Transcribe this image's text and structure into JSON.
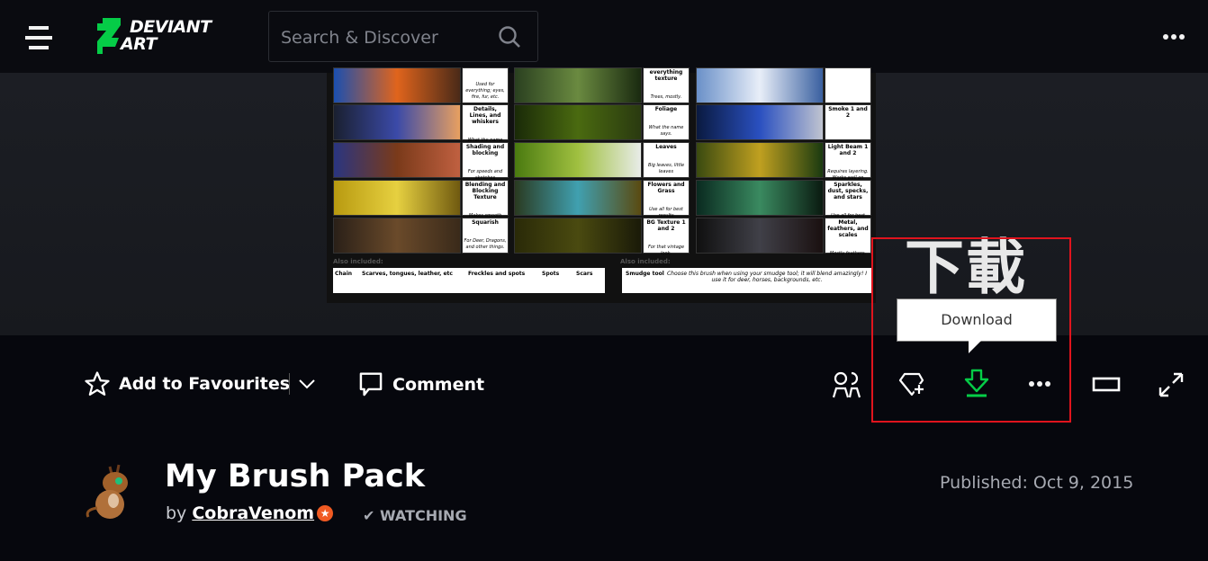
{
  "header": {
    "logo_text": [
      "DEVIANT",
      "ART"
    ],
    "logo_color": "#05cc47",
    "search": {
      "placeholder": "Search & Discover"
    }
  },
  "artwork": {
    "columns": [
      {
        "labels": [
          "",
          "Details, Lines, and whiskers",
          "Shading and blocking",
          "Blending and Blocking Texture",
          "Squarish"
        ],
        "captions": [
          "Used for everything; eyes, fire, fur, etc.",
          "What the name says.",
          "For speeds and sketches",
          "Makes smooth things.",
          "For Deer, Dragons, and other things."
        ],
        "colors": [
          [
            "#1b4fb0",
            "#e0641c",
            "#4a2a18"
          ],
          [
            "#1a2030",
            "#3b4aa8",
            "#e8a060"
          ],
          [
            "#2a3580",
            "#7a3a1a",
            "#c06040"
          ],
          [
            "#b89a10",
            "#e6d040",
            "#705a10"
          ],
          [
            "#2a2018",
            "#6a4a2a",
            "#3a2a1a"
          ]
        ]
      },
      {
        "labels": [
          "everything texture",
          "Foliage",
          "Leaves",
          "Flowers and Grass",
          "BG Texture 1 and 2"
        ],
        "captions": [
          "Trees, mostly.",
          "What the name says.",
          "Big leaves, little leaves",
          "Use all for best results",
          "For that vintage look."
        ],
        "colors": [
          [
            "#2a4020",
            "#6a8a40",
            "#1a2a10"
          ],
          [
            "#1a2a08",
            "#4a6a10",
            "#2a3a10"
          ],
          [
            "#4a7a10",
            "#a0c040",
            "#e8ece8"
          ],
          [
            "#2a3a20",
            "#40a0b0",
            "#5a4a10"
          ],
          [
            "#2a2a08",
            "#4a4a10",
            "#1a1a08"
          ]
        ]
      },
      {
        "labels": [
          "",
          "Smoke 1 and 2",
          "Light Beam 1 and 2",
          "Sparkles, dust, specks, and stars",
          "Metal, feathers, and scales"
        ],
        "captions": [
          "",
          "",
          "Requires layering. Works well on Color Dodge setting.",
          "Use all for best results.",
          "Mostly feathers."
        ],
        "colors": [
          [
            "#6a90c8",
            "#e8eef8",
            "#3a60a0"
          ],
          [
            "#0a1a40",
            "#2a50c0",
            "#c0c4d0"
          ],
          [
            "#3a4a10",
            "#c0a020",
            "#1a3a10"
          ],
          [
            "#0a2a20",
            "#3a8a60",
            "#0a1a10"
          ],
          [
            "#101010",
            "#404048",
            "#1a1010"
          ]
        ]
      }
    ],
    "also_included_label": "Also included:",
    "also_left": [
      "Chain",
      "Scarves, tongues, leather, etc",
      "Freckles and spots",
      "Spots",
      "Scars"
    ],
    "also_right": {
      "label": "Smudge tool",
      "text": "Choose this brush when using your smudge tool; it will blend amazingly! I use it for deer, horses, backgrounds, etc."
    }
  },
  "annotation": {
    "text": "下載",
    "box_color": "#e0141d"
  },
  "tooltip": {
    "text": "Download"
  },
  "actions": {
    "favourite_label": "Add to Favourites",
    "comment_label": "Comment",
    "download_color": "#05cc47"
  },
  "deviation": {
    "title": "My Brush Pack",
    "by": "by",
    "author": "CobraVenom",
    "watching": "WATCHING",
    "published": "Published: Oct 9, 2015"
  }
}
